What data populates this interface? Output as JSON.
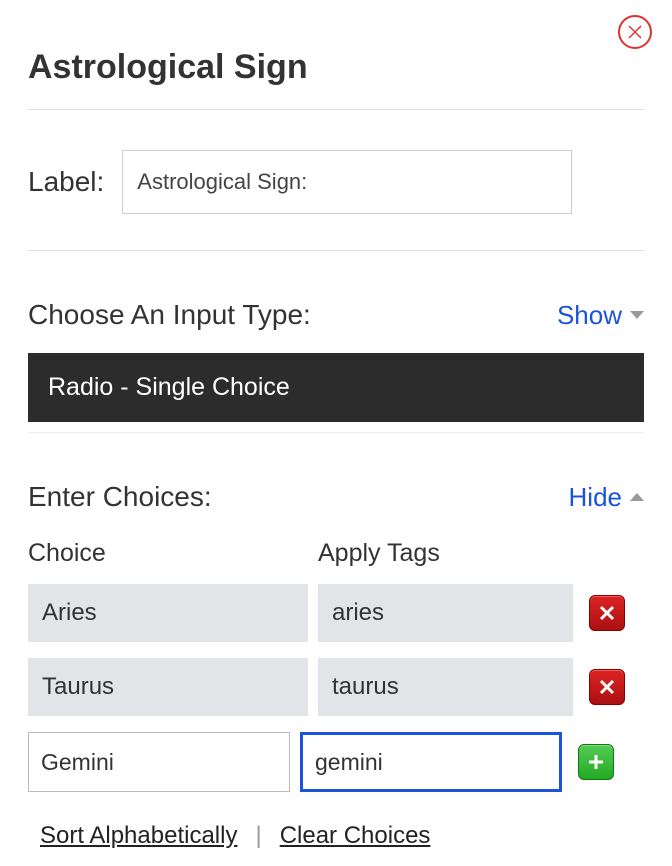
{
  "title": "Astrological Sign",
  "labelSection": {
    "label": "Label:",
    "value": "Astrological Sign:"
  },
  "inputTypeSection": {
    "heading": "Choose An Input Type:",
    "toggle": "Show",
    "selected": "Radio - Single Choice"
  },
  "choicesSection": {
    "heading": "Enter Choices:",
    "toggle": "Hide",
    "columns": {
      "choice": "Choice",
      "tags": "Apply Tags"
    },
    "rows": [
      {
        "choice": "Aries",
        "tag": "aries"
      },
      {
        "choice": "Taurus",
        "tag": "taurus"
      }
    ],
    "newRow": {
      "choice": "Gemini",
      "tag": "gemini"
    }
  },
  "actions": {
    "sort": "Sort Alphabetically",
    "clear": "Clear Choices"
  }
}
